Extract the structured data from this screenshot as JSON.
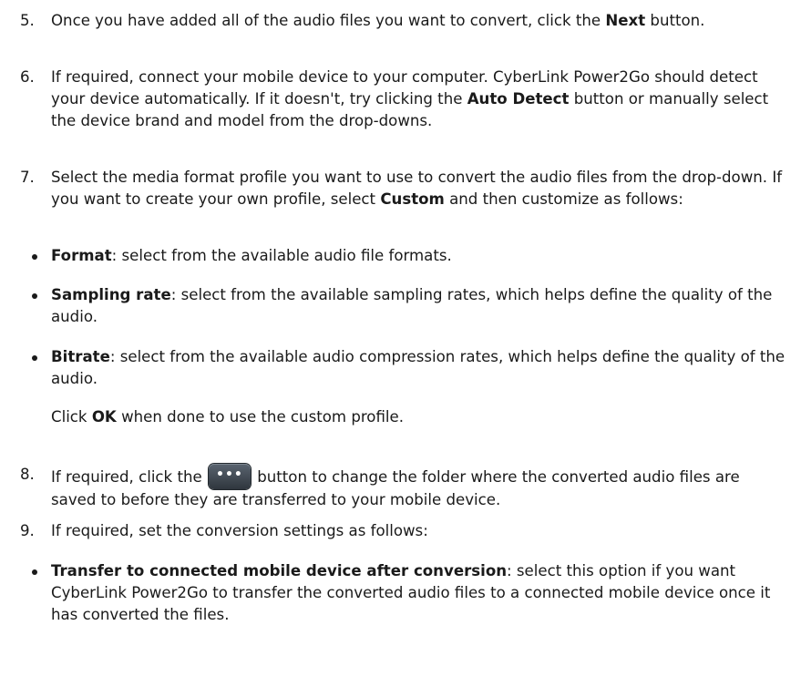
{
  "steps": {
    "s5": {
      "num": "5.",
      "t1": "Once you have added all of the audio files you want to convert, click the ",
      "b1": "Next",
      "t2": " button."
    },
    "s6": {
      "num": "6.",
      "t1": "If required, connect your mobile device to your computer. CyberLink Power2Go should detect your device automatically. If it doesn't, try clicking the ",
      "b1": "Auto Detect",
      "t2": " button or manually select the device brand and model from the drop-downs."
    },
    "s7": {
      "num": "7.",
      "t1": "Select the media format profile you want to use to convert the audio files from the drop-down. If you want to create your own profile, select ",
      "b1": "Custom",
      "t2": " and then customize as follows:"
    },
    "s8": {
      "num": "8.",
      "t1": "If required, click the ",
      "btn": "•••",
      "t2": " button to change the folder where the converted audio files are saved to before they are transferred to your mobile device."
    },
    "s9": {
      "num": "9.",
      "t1": "If required, set the conversion settings as follows:"
    }
  },
  "bullets_s7": [
    {
      "term": "Format",
      "text": ": select from the available audio file formats."
    },
    {
      "term": "Sampling rate",
      "text": ": select from the available sampling rates, which helps define the quality of the audio."
    },
    {
      "term": "Bitrate",
      "text": ": select from the available audio compression rates, which helps define the quality of the audio."
    }
  ],
  "custom_note": {
    "t1": "Click ",
    "b1": "OK",
    "t2": " when done to use the custom profile."
  },
  "bullets_s9": [
    {
      "term": "Transfer to connected mobile device after conversion",
      "text": ": select this option if you want CyberLink Power2Go to transfer the converted audio files to a connected mobile device once it has converted the files."
    }
  ]
}
